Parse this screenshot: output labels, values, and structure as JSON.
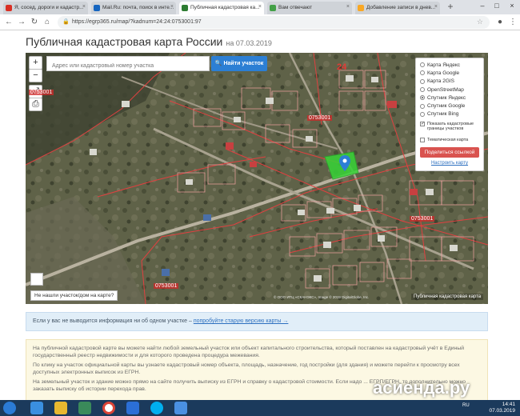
{
  "browser": {
    "tabs": [
      {
        "label": "Я, сосед, дороги и кадастр...",
        "color": "#d93025"
      },
      {
        "label": "Mail.Ru: почта, поиск в инте...",
        "color": "#1565c0"
      },
      {
        "label": "Публичная кадастровая ка...",
        "color": "#2e7d32"
      },
      {
        "label": "Вам отвечают",
        "color": "#43a047"
      },
      {
        "label": "Добавление записи в днев...",
        "color": "#f9a825"
      }
    ],
    "url": "https://egrp365.ru/map/?kadnum=24:24:0753001:97"
  },
  "page": {
    "title": "Публичная кадастровая карта России",
    "date": "на 07.03.2019"
  },
  "map": {
    "search_placeholder": "Адрес или кадастровый номер участка",
    "search_button": "Найти участок",
    "zoom_in": "+",
    "zoom_out": "−",
    "basemaps": [
      "Карта Яндекс",
      "Карта Google",
      "Карта 2GIS",
      "OpenStreetMap",
      "Спутник Яндекс",
      "Спутник Google",
      "Спутник Bing"
    ],
    "selected_basemap": "Спутник Яндекс",
    "show_boundaries": "Показать кадастровые границы участков",
    "thematic_map": "Тематическая карта",
    "share_button": "Поделиться ссылкой",
    "setup_link": "Настроить карту",
    "not_found": "Не нашли участок/дом на карте?",
    "attribution": "© ООО ИТЦ «СКАНЭКС», Image © 2019 DigitalGlobe, Inc.",
    "pkk_label": "Публичная кадастровая карта",
    "region_number": "24",
    "block_labels": [
      "0753001",
      "0753001",
      "0753001",
      "0753001"
    ]
  },
  "info": {
    "text": "Если у вас не выводится информация ни об одном участке –",
    "link": "попробуйте старую версию карты →"
  },
  "description": {
    "p1": "На публичной кадастровой карте вы можете найти любой земельный участок или объект капитального строительства, который поставлен на кадастровый учёт в Единый государственный реестр недвижимости и для которого проведена процедура межевания.",
    "p2": "По клику на участок официальной карты вы узнаете кадастровый номер объекта, площадь, назначение, год постройки (для здания) и можете перейти к просмотру всех доступных электронных выписок из ЕГРН.",
    "p3": "На земельный участок и здание можно прямо на сайте получить выписку из ЕГРН и справку о кадастровой стоимости. Если надо ... ЕГРП/ЕГРН, то дополнительно можно заказать выписку об истории перехода прав."
  },
  "taskbar": {
    "lang": "RU",
    "time": "14:41",
    "date": "07.03.2019"
  },
  "watermark": "асиенда.ру"
}
